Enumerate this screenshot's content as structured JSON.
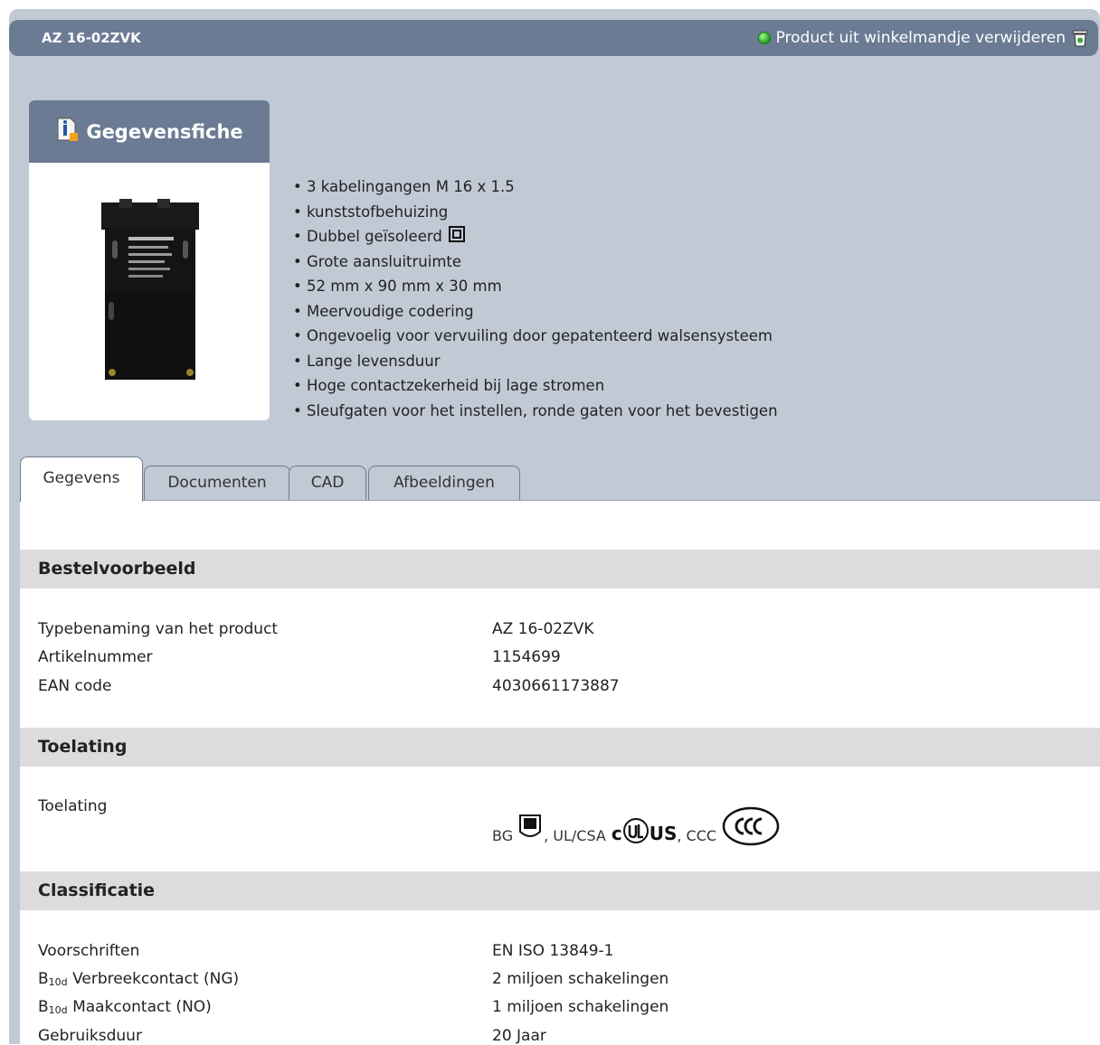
{
  "header": {
    "product_name": "AZ 16-02ZVK",
    "remove_label": "Product uit winkelmandje verwijderen",
    "remove_icon": "trash-icon",
    "status_icon": "green-dot-icon"
  },
  "datasheet": {
    "label": "Gegevensfiche",
    "icon": "info-document-icon"
  },
  "features": [
    "3 kabelingangen M 16 x 1.5",
    "kunststofbehuizing",
    "Dubbel geïsoleerd",
    "Grote aansluitruimte",
    "52 mm x 90 mm x 30 mm",
    "Meervoudige codering",
    "Ongevoelig voor vervuiling door gepatenteerd walsensysteem",
    "Lange levensduur",
    "Hoge contactzekerheid bij lage stromen",
    "Sleufgaten voor het instellen, ronde gaten voor het bevestigen"
  ],
  "tabs": [
    {
      "label": "Gegevens",
      "active": true
    },
    {
      "label": "Documenten",
      "active": false
    },
    {
      "label": "CAD",
      "active": false
    },
    {
      "label": "Afbeeldingen",
      "active": false
    }
  ],
  "sections": {
    "order": {
      "title": "Bestelvoorbeeld",
      "rows": [
        {
          "label": "Typebenaming van het product",
          "value": "AZ 16-02ZVK"
        },
        {
          "label": "Artikelnummer",
          "value": "1154699"
        },
        {
          "label": "EAN code",
          "value": "4030661173887"
        }
      ]
    },
    "approval": {
      "title": "Toelating",
      "label": "Toelating",
      "items": [
        "BG",
        "UL/CSA",
        "CCC"
      ],
      "separator": ", ",
      "ul_c": "c",
      "ul_us": "US"
    },
    "classification": {
      "title": "Classificatie",
      "rows": [
        {
          "label": "Voorschriften",
          "value": "EN ISO 13849-1"
        },
        {
          "label_prefix": "B",
          "label_sub": "10d",
          "label": "Verbreekcontact (NG)",
          "value": "2 miljoen schakelingen"
        },
        {
          "label_prefix": "B",
          "label_sub": "10d",
          "label": "Maakcontact (NO)",
          "value": "1 miljoen schakelingen"
        },
        {
          "label": "Gebruiksduur",
          "value": "20 Jaar"
        }
      ]
    }
  },
  "colors": {
    "page_bg": "#c1c9d5",
    "header_bg": "#6b7b93",
    "section_bg": "#dcdcdc"
  }
}
